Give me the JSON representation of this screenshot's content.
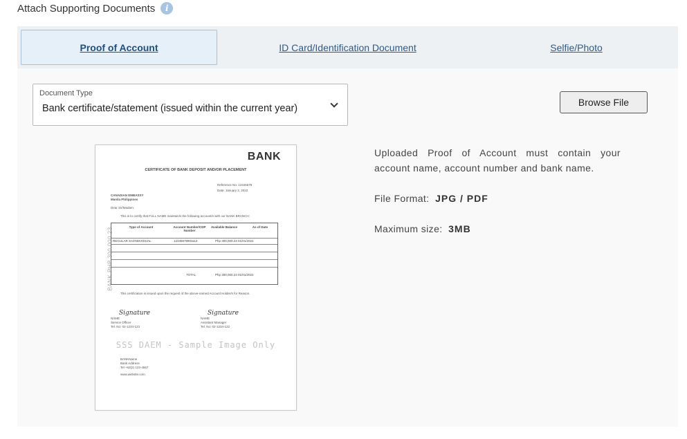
{
  "header": {
    "title": "Attach Supporting Documents",
    "info_icon": "info-icon",
    "info_glyph": "i"
  },
  "tabs": [
    {
      "label": "Proof of Account",
      "active": true
    },
    {
      "label": "ID Card/Identification Document",
      "active": false
    },
    {
      "label": "Selfie/Photo",
      "active": false
    }
  ],
  "document_type": {
    "label": "Document Type",
    "value": "Bank certificate/statement (issued within the current year)"
  },
  "browse_button": "Browse File",
  "requirements": {
    "desc_line1": "Uploaded Proof of Account must contain your",
    "desc_line2": "account name, account number and bank name.",
    "format_label": "File Format:",
    "format_value": "JPG / PDF",
    "size_label": "Maximum size:",
    "size_value": "3MB"
  },
  "sample_document": {
    "bank": "BANK",
    "title": "CERTIFICATE OF BANK DEPOSIT AND/OR PLACEMENT",
    "reference": "Reference No: 12345678",
    "date": "Date: January 2, 2022",
    "addressee_1": "CANADIAN EMBASSY",
    "addressee_2": "Manila Philippines",
    "salutation": "Dear Sir/Madam:",
    "intro": "This is to certify that FULL NAME maintain/s the following account/s with our BANK BRANCH:",
    "side_text": "BANK PHP 300,000.23",
    "table_headers": [
      "Type of Account",
      "Account Number/CDP Number",
      "Available Balance",
      "As of Date"
    ],
    "row_type": "REGULAR SA/INDIVIDUAL",
    "row_number": "12345678901112",
    "row_balance": "Php 300,000.23 01/01/2022",
    "total_label": "TOTAL",
    "total_value": "Php 300,000.23 01/01/2022",
    "footer_note": "This certification is issued upon the request of the above-named Account Holder/s for Reason.",
    "sig1_script": "Signature",
    "sig1_name": "NAME",
    "sig1_title": "Service Officer",
    "sig1_tel": "Tel. No: 02-1234-123",
    "sig2_script": "Signature",
    "sig2_name": "NAME",
    "sig2_title": "Assistant Manager",
    "sig2_tel": "Tel. No: 02-1234-122",
    "watermark": "SSS DAEM - Sample Image Only",
    "bank_name": "BANKName",
    "bank_addr": "Bank Address",
    "bank_tel": "Tel +63(2) 123-4567",
    "bank_web": "www.website.com"
  }
}
